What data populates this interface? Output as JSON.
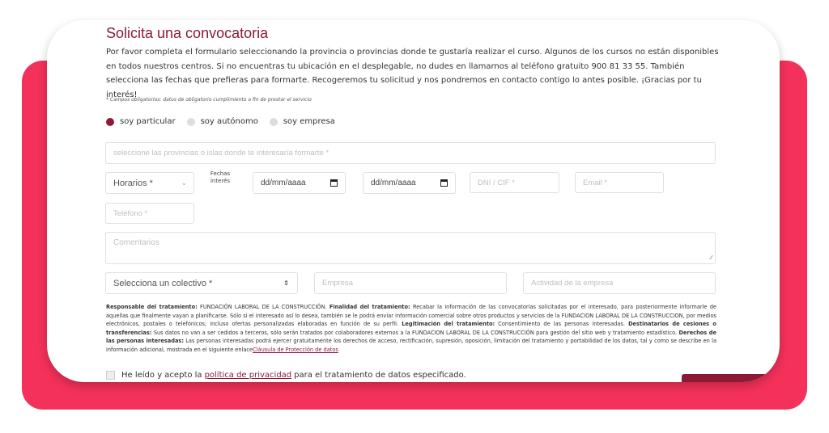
{
  "form": {
    "title": "Solicita una convocatoria",
    "intro": "Por favor completa el formulario seleccionando la provincia o provincias donde te gustaría realizar el curso. Algunos de los cursos no están disponibles en todos nuestros centros. Si no encuentras tu ubicación en el desplegable, no dudes en llamarnos al teléfono gratuito 900 81 33 55. También selecciona las fechas que prefieras para formarte. Recogeremos tu solicitud y nos pondremos en contacto contigo lo antes posible. ¡Gracias por tu interés!",
    "required_note": "* Campos obligatorios: datos de obligatorio cumplimiento a fin de prestar el servicio",
    "radios": [
      {
        "label": "soy particular",
        "checked": true
      },
      {
        "label": "soy autónomo",
        "checked": false
      },
      {
        "label": "soy empresa",
        "checked": false
      }
    ],
    "provinces_placeholder": "seleccione las provincias o islas donde te interesaría formarte *",
    "horarios_value": "Horarios *",
    "fechas_label": "Fechas interés",
    "date1": "dd/mm/aaaa",
    "date2": "dd/mm/aaaa",
    "dni_placeholder": "DNI / CIF *",
    "email_placeholder": "Email *",
    "telefono_placeholder": "Teléfono *",
    "comentarios_placeholder": "Comentarios",
    "colectivo_value": "Selecciona un colectivo *",
    "empresa_placeholder": "Empresa",
    "actividad_placeholder": "Actividad de la empresa",
    "legal": {
      "resp_label": "Responsable del tratamiento:",
      "resp_text": "FUNDACIÓN LABORAL DE LA CONSTRUCCIÓN.",
      "fin_label": "Finalidad del tratamiento:",
      "fin_text": "Recabar la información de las convocatorias solicitadas por el interesado, para posteriormente informarle de aquellas que finalmente vayan a planificarse. Sólo si el interesado así lo desea, también se le podrá enviar información comercial sobre otros productos y servicios de la FUNDACION LABORAL DE LA CONSTRUCCION, por medios electrónicos, postales o telefónicos; incluso ofertas personalizadas elaboradas en función de su perfil.",
      "leg_label": "Legitimación del tratamiento:",
      "leg_text": "Consentimiento de las personas interesadas.",
      "dest_label": "Destinatarios de cesiones o transferencias:",
      "dest_text": "Sus datos no van a ser cedidos a terceros, sólo serán tratados por colaboradores externos a la FUNDACION LABORAL DE LA CONSTRUCCIÓN para gestión del sitio web y tratamiento estadístico.",
      "der_label": "Derechos de las personas interesadas:",
      "der_text": "Las personas interesadas podrá ejercer gratuitamente los derechos de acceso, rectificación, supresión, oposición, limitación del tratamiento y portabilidad de los datos, tal y como se describe en la información adicional, mostrada en el siguiente enlace",
      "link": "Cláusula de Protección de datos"
    },
    "accept_prefix": "He leído y acepto la",
    "accept_link": "política de privacidad",
    "accept_suffix": "para el tratamiento de datos especificado."
  },
  "colors": {
    "brand": "#8c1a36",
    "backdrop": "#f4315a"
  }
}
